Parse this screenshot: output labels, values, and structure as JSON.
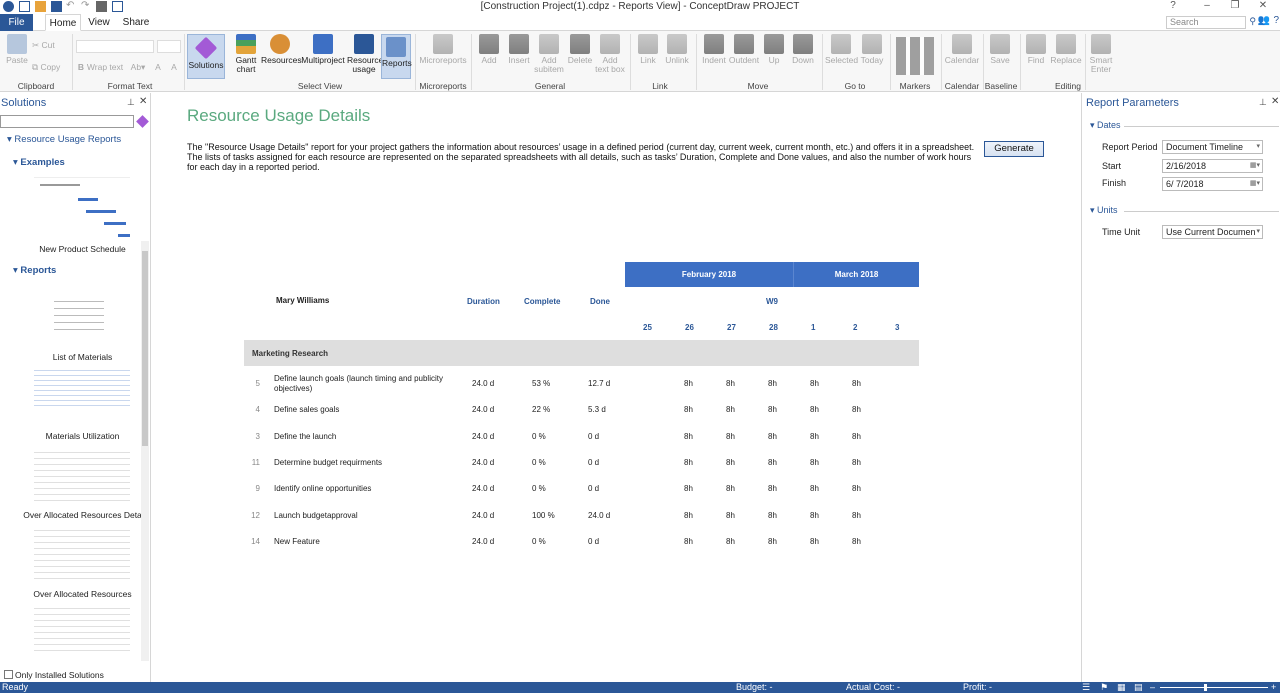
{
  "window": {
    "title": "[Construction Project(1).cdpz - Reports View] - ConceptDraw PROJECT",
    "search_placeholder": "Search"
  },
  "tabs": [
    {
      "label": "File"
    },
    {
      "label": "Home"
    },
    {
      "label": "View"
    },
    {
      "label": "Share"
    }
  ],
  "ribbon": {
    "clipboard": {
      "paste": "Paste",
      "cut": "Cut",
      "copy": "Copy",
      "group": "Clipboard"
    },
    "format_text": {
      "wrap": "Wrap text",
      "group": "Format Text"
    },
    "select_view": {
      "solutions": "Solutions",
      "gantt": "Gantt chart",
      "resources": "Resources",
      "multiproject": "Multiproject",
      "resource_usage": "Resource usage",
      "reports": "Reports",
      "group": "Select View"
    },
    "microreports": {
      "label": "Microreports",
      "group": "Microreports"
    },
    "general": {
      "add": "Add",
      "insert": "Insert",
      "add_subitem": "Add subitem",
      "delete": "Delete",
      "add_text_box": "Add text box",
      "group": "General"
    },
    "link": {
      "link": "Link",
      "unlink": "Unlink",
      "group": "Link"
    },
    "move": {
      "indent": "Indent",
      "outdent": "Outdent",
      "up": "Up",
      "down": "Down",
      "group": "Move"
    },
    "goto": {
      "selected": "Selected",
      "today": "Today",
      "group": "Go to"
    },
    "markers": {
      "group": "Markers"
    },
    "calendar": {
      "label": "Calendar",
      "group": "Calendar"
    },
    "baseline": {
      "save": "Save",
      "group": "Baseline"
    },
    "editing": {
      "find": "Find",
      "replace": "Replace",
      "group": "Editing"
    },
    "smart": {
      "label": "Smart Enter"
    }
  },
  "solutions_panel": {
    "title": "Solutions",
    "root": "Resource Usage Reports",
    "examples_label": "Examples",
    "examples": [
      "New Product Schedule"
    ],
    "reports_label": "Reports",
    "reports": [
      "List of Materials",
      "Materials Utilization",
      "Over Allocated Resources Deta",
      "Over Allocated Resources"
    ],
    "only_installed": "Only Installed Solutions"
  },
  "report": {
    "title": "Resource Usage Details",
    "description": "The \"Resource Usage Details\" report for your project gathers the information about resources’ usage in a defined period (current day, current week, current month, etc.) and offers it in a spreadsheet. The lists of tasks assigned for each resource are represented on the separated spreadsheets with all details, such as tasks’ Duration, Complete and Done values, and also the number of work hours for each day in a reported period.",
    "generate": "Generate",
    "resource": "Mary Williams",
    "columns": {
      "duration": "Duration",
      "complete": "Complete",
      "done": "Done"
    },
    "months": [
      "February 2018",
      "March 2018"
    ],
    "week": "W9",
    "days": [
      "25",
      "26",
      "27",
      "28",
      "1",
      "2",
      "3"
    ],
    "group": "Marketing Research",
    "rows": [
      {
        "id": "5",
        "name": "Define launch goals (launch timing and publicity objectives)",
        "duration": "24.0 d",
        "complete": "53 %",
        "done": "12.7 d",
        "hours": [
          "",
          "8h",
          "8h",
          "8h",
          "8h",
          "8h",
          ""
        ]
      },
      {
        "id": "4",
        "name": "Define sales goals",
        "duration": "24.0 d",
        "complete": "22 %",
        "done": "5.3 d",
        "hours": [
          "",
          "8h",
          "8h",
          "8h",
          "8h",
          "8h",
          ""
        ]
      },
      {
        "id": "3",
        "name": "Define the launch",
        "duration": "24.0 d",
        "complete": "0 %",
        "done": "0 d",
        "hours": [
          "",
          "8h",
          "8h",
          "8h",
          "8h",
          "8h",
          ""
        ]
      },
      {
        "id": "11",
        "name": "Determine budget requirments",
        "duration": "24.0 d",
        "complete": "0 %",
        "done": "0 d",
        "hours": [
          "",
          "8h",
          "8h",
          "8h",
          "8h",
          "8h",
          ""
        ]
      },
      {
        "id": "9",
        "name": "Identify online opportunities",
        "duration": "24.0 d",
        "complete": "0 %",
        "done": "0 d",
        "hours": [
          "",
          "8h",
          "8h",
          "8h",
          "8h",
          "8h",
          ""
        ]
      },
      {
        "id": "12",
        "name": "Launch budgetapproval",
        "duration": "24.0 d",
        "complete": "100 %",
        "done": "24.0 d",
        "hours": [
          "",
          "8h",
          "8h",
          "8h",
          "8h",
          "8h",
          ""
        ]
      },
      {
        "id": "14",
        "name": "New Feature",
        "duration": "24.0 d",
        "complete": "0 %",
        "done": "0 d",
        "hours": [
          "",
          "8h",
          "8h",
          "8h",
          "8h",
          "8h",
          ""
        ]
      }
    ]
  },
  "params": {
    "title": "Report Parameters",
    "dates_label": "Dates",
    "report_period_label": "Report Period",
    "report_period_value": "Document Timeline",
    "start_label": "Start",
    "start_value": "2/16/2018",
    "finish_label": "Finish",
    "finish_value": "6/  7/2018",
    "units_label": "Units",
    "time_unit_label": "Time Unit",
    "time_unit_value": "Use Current Documen"
  },
  "status": {
    "ready": "Ready",
    "budget": "Budget: -",
    "actual": "Actual Cost: -",
    "profit": "Profit: -"
  }
}
